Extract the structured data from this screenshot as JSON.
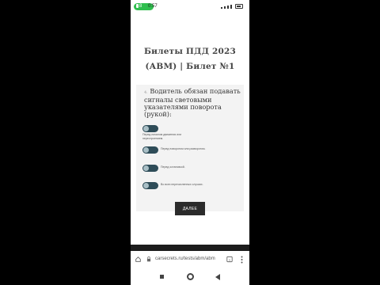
{
  "status_bar": {
    "indicator": "8",
    "time": "0:57"
  },
  "page": {
    "title": "Билеты ПДД 2023 (АВМ) | Билет №1"
  },
  "question": {
    "number": "4.",
    "text": "Водитель обязан подавать сигналы световыми указателями поворота (рукой):",
    "options": [
      "Перед началом движения или перестроением.",
      "Перед поворотом или разворотом.",
      "Перед остановкой.",
      "Во всех перечисленных случаях."
    ]
  },
  "next_button": "ДАЛЕЕ",
  "browser": {
    "url": "carsecrets.ru/tests/abm/abm"
  },
  "colors": {
    "toggle": "#2e4c58",
    "status_pill": "#2fbf4e",
    "button": "#2b2b2b"
  }
}
